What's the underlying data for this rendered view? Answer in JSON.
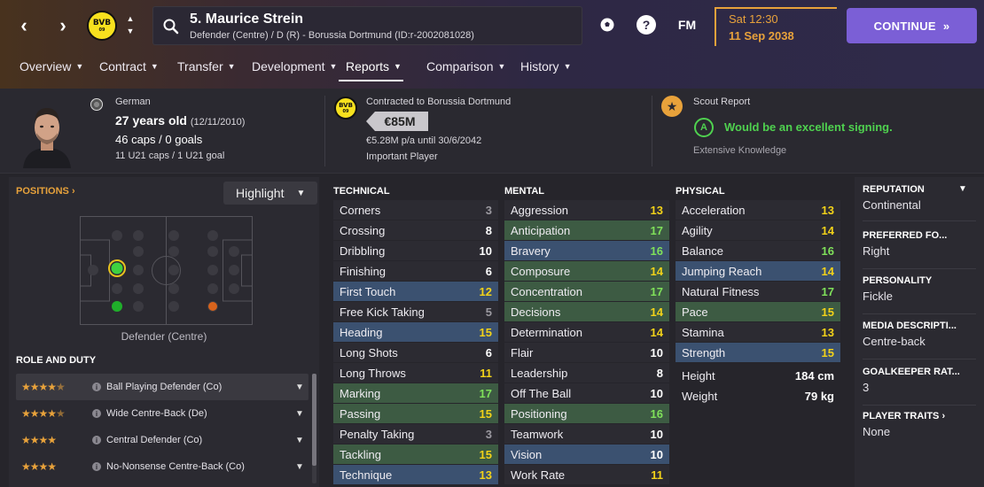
{
  "header": {
    "player_title": "5. Maurice Strein",
    "player_subtitle": "Defender (Centre) / D (R) - Borussia Dortmund (ID:r-2002081028)",
    "club_crest_text": "BVB",
    "club_crest_sub": "09",
    "fm_label": "FM",
    "help_label": "?",
    "date_time": "Sat 12:30",
    "date_day": "11 Sep 2038",
    "continue_label": "CONTINUE",
    "icons": [
      "back-arrow-icon",
      "forward-arrow-icon",
      "search-icon",
      "football-icon",
      "help-icon"
    ]
  },
  "tabs": [
    {
      "label": "Overview"
    },
    {
      "label": "Contract"
    },
    {
      "label": "Transfer"
    },
    {
      "label": "Development"
    },
    {
      "label": "Reports"
    },
    {
      "label": "Comparison"
    },
    {
      "label": "History"
    }
  ],
  "active_tab": "Reports",
  "profile": {
    "nationality": "German",
    "age": "27 years old",
    "dob": "(12/11/2010)",
    "caps": "46 caps / 0 goals",
    "u21": "11 U21 caps / 1 U21 goal",
    "contract_to": "Contracted to Borussia Dortmund",
    "value": "€85M",
    "wage": "€5.28M p/a until 30/6/2042",
    "squad_status": "Important Player",
    "scout_title": "Scout Report",
    "scout_grade": "A",
    "scout_verdict": "Would be an excellent signing.",
    "scout_knowledge": "Extensive Knowledge"
  },
  "positions": {
    "link_label": "POSITIONS",
    "highlight_label": "Highlight",
    "caption": "Defender (Centre)"
  },
  "roles": {
    "title": "ROLE AND DUTY",
    "items": [
      {
        "stars": "★★★★★",
        "name": "Ball Playing Defender (Co)",
        "rating": 4.5
      },
      {
        "stars": "★★★★★",
        "name": "Wide Centre-Back (De)",
        "rating": 4.5
      },
      {
        "stars": "★★★★",
        "name": "Central Defender (Co)",
        "rating": 4
      },
      {
        "stars": "★★★★",
        "name": "No-Nonsense Centre-Back (Co)",
        "rating": 4
      }
    ]
  },
  "technical": {
    "title": "TECHNICAL",
    "rows": [
      {
        "name": "Corners",
        "value": "3",
        "color": "grey",
        "hl": ""
      },
      {
        "name": "Crossing",
        "value": "8",
        "color": "white",
        "hl": ""
      },
      {
        "name": "Dribbling",
        "value": "10",
        "color": "white",
        "hl": ""
      },
      {
        "name": "Finishing",
        "value": "6",
        "color": "white",
        "hl": ""
      },
      {
        "name": "First Touch",
        "value": "12",
        "color": "yellow",
        "hl": "blue"
      },
      {
        "name": "Free Kick Taking",
        "value": "5",
        "color": "grey",
        "hl": ""
      },
      {
        "name": "Heading",
        "value": "15",
        "color": "yellow",
        "hl": "blue"
      },
      {
        "name": "Long Shots",
        "value": "6",
        "color": "white",
        "hl": ""
      },
      {
        "name": "Long Throws",
        "value": "11",
        "color": "yellow",
        "hl": ""
      },
      {
        "name": "Marking",
        "value": "17",
        "color": "lgreen",
        "hl": "green"
      },
      {
        "name": "Passing",
        "value": "15",
        "color": "yellow",
        "hl": "green"
      },
      {
        "name": "Penalty Taking",
        "value": "3",
        "color": "grey",
        "hl": ""
      },
      {
        "name": "Tackling",
        "value": "15",
        "color": "yellow",
        "hl": "green"
      },
      {
        "name": "Technique",
        "value": "13",
        "color": "yellow",
        "hl": "blue"
      }
    ]
  },
  "mental": {
    "title": "MENTAL",
    "rows": [
      {
        "name": "Aggression",
        "value": "13",
        "color": "yellow",
        "hl": ""
      },
      {
        "name": "Anticipation",
        "value": "17",
        "color": "lgreen",
        "hl": "green"
      },
      {
        "name": "Bravery",
        "value": "16",
        "color": "lgreen",
        "hl": "blue"
      },
      {
        "name": "Composure",
        "value": "14",
        "color": "yellow",
        "hl": "green"
      },
      {
        "name": "Concentration",
        "value": "17",
        "color": "lgreen",
        "hl": "green"
      },
      {
        "name": "Decisions",
        "value": "14",
        "color": "yellow",
        "hl": "green"
      },
      {
        "name": "Determination",
        "value": "14",
        "color": "yellow",
        "hl": ""
      },
      {
        "name": "Flair",
        "value": "10",
        "color": "white",
        "hl": ""
      },
      {
        "name": "Leadership",
        "value": "8",
        "color": "white",
        "hl": ""
      },
      {
        "name": "Off The Ball",
        "value": "10",
        "color": "white",
        "hl": ""
      },
      {
        "name": "Positioning",
        "value": "16",
        "color": "lgreen",
        "hl": "green"
      },
      {
        "name": "Teamwork",
        "value": "10",
        "color": "white",
        "hl": ""
      },
      {
        "name": "Vision",
        "value": "10",
        "color": "white",
        "hl": "blue"
      },
      {
        "name": "Work Rate",
        "value": "11",
        "color": "yellow",
        "hl": ""
      }
    ]
  },
  "physical": {
    "title": "PHYSICAL",
    "rows": [
      {
        "name": "Acceleration",
        "value": "13",
        "color": "yellow",
        "hl": ""
      },
      {
        "name": "Agility",
        "value": "14",
        "color": "yellow",
        "hl": ""
      },
      {
        "name": "Balance",
        "value": "16",
        "color": "lgreen",
        "hl": ""
      },
      {
        "name": "Jumping Reach",
        "value": "14",
        "color": "yellow",
        "hl": "blue"
      },
      {
        "name": "Natural Fitness",
        "value": "17",
        "color": "lgreen",
        "hl": ""
      },
      {
        "name": "Pace",
        "value": "15",
        "color": "yellow",
        "hl": "green"
      },
      {
        "name": "Stamina",
        "value": "13",
        "color": "yellow",
        "hl": ""
      },
      {
        "name": "Strength",
        "value": "15",
        "color": "yellow",
        "hl": "blue"
      }
    ],
    "height_label": "Height",
    "height_value": "184 cm",
    "weight_label": "Weight",
    "weight_value": "79 kg"
  },
  "sidebar": {
    "reputation_label": "REPUTATION",
    "reputation_value": "Continental",
    "foot_label": "PREFERRED FO...",
    "foot_value": "Right",
    "personality_label": "PERSONALITY",
    "personality_value": "Fickle",
    "media_label": "MEDIA DESCRIPTI...",
    "media_value": "Centre-back",
    "gk_label": "GOALKEEPER RAT...",
    "gk_value": "3",
    "traits_label": "PLAYER TRAITS",
    "traits_value": "None"
  },
  "colors": {
    "accent_orange": "#e8a23b",
    "continue_purple": "#7b5fd6",
    "highlight_blue": "#3b5170",
    "highlight_green": "#3d5b43",
    "attr_yellow": "#f2d219",
    "attr_green": "#7fe05a"
  }
}
